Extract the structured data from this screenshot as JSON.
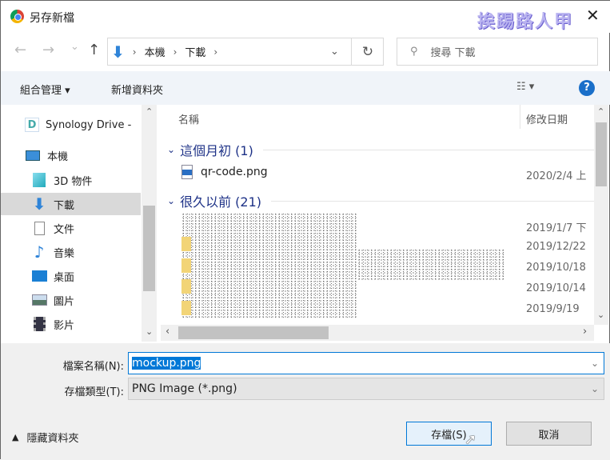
{
  "window": {
    "title": "另存新檔",
    "watermark": "挨踢路人甲",
    "close": "✕"
  },
  "nav": {
    "back": "←",
    "forward": "→",
    "recent": "⌄",
    "up": "↑"
  },
  "address": {
    "crumbs": [
      "本機",
      "下載"
    ],
    "sep": "›",
    "dropdown": "⌄",
    "refresh": "↻"
  },
  "search": {
    "placeholder": "搜尋 下載",
    "icon": "⚲"
  },
  "toolbar": {
    "organize": "組合管理 ▾",
    "new_folder": "新增資料夾",
    "view": "☷ ▾",
    "help": "?"
  },
  "sidebar": {
    "items": [
      {
        "label": "Synology Drive -",
        "icon": "synology-icon"
      },
      {
        "label": "本機",
        "icon": "computer-icon"
      },
      {
        "label": "3D 物件",
        "icon": "cube-icon"
      },
      {
        "label": "下載",
        "icon": "download-icon",
        "selected": true
      },
      {
        "label": "文件",
        "icon": "document-icon"
      },
      {
        "label": "音樂",
        "icon": "music-icon"
      },
      {
        "label": "桌面",
        "icon": "desktop-icon"
      },
      {
        "label": "圖片",
        "icon": "pictures-icon"
      },
      {
        "label": "影片",
        "icon": "video-icon"
      }
    ]
  },
  "columns": {
    "name": "名稱",
    "modified": "修改日期"
  },
  "groups": [
    {
      "label": "這個月初 (1)",
      "files": [
        {
          "name": "qr-code.png",
          "date": "2020/2/4 上"
        }
      ]
    },
    {
      "label": "很久以前 (21)",
      "dates": [
        "2019/1/7 下",
        "2019/12/22",
        "2019/10/18",
        "2019/10/14",
        "2019/9/19"
      ]
    }
  ],
  "form": {
    "filename_label": "檔案名稱(N):",
    "filename": "mockup.png",
    "type_label": "存檔類型(T):",
    "type": "PNG Image (*.png)",
    "hide_folders": "隱藏資料夾",
    "save": "存檔(S)",
    "cancel": "取消"
  },
  "colors": {
    "accent": "#0078d7",
    "selection": "#d9d9d9",
    "group": "#1e3287"
  }
}
